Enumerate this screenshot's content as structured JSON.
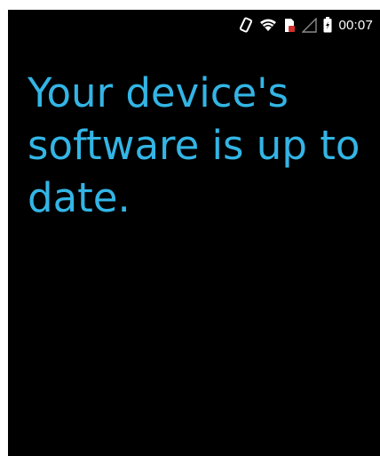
{
  "status_bar": {
    "icons": [
      "screen-rotation-icon",
      "wifi-icon",
      "sim-card-icon",
      "signal-strength-icon",
      "battery-icon"
    ],
    "time": "00:07"
  },
  "main": {
    "message_lines": [
      "Your device's",
      "software is up to",
      "date."
    ]
  },
  "colors": {
    "background": "#000000",
    "accent": "#33b5e5",
    "status_icon": "#ffffff",
    "sim_badge": "#d32f2f"
  }
}
